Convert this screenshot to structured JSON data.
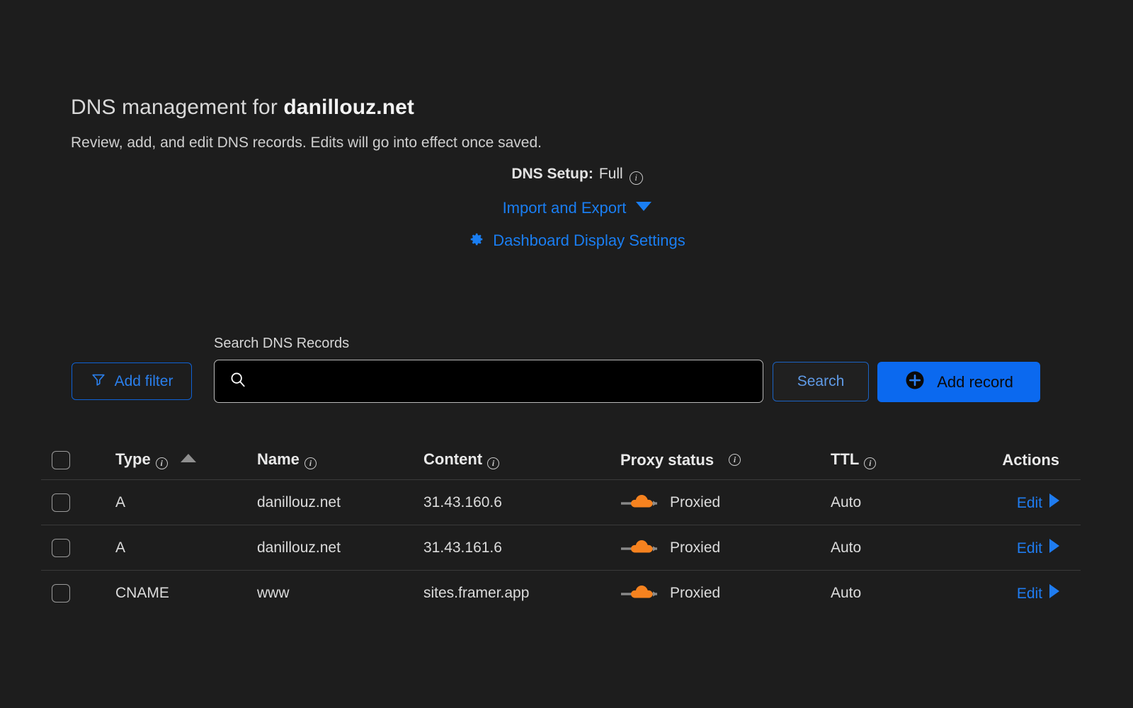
{
  "header": {
    "title_prefix": "DNS management for ",
    "domain": "danillouz.net",
    "subtitle": "Review, add, and edit DNS records. Edits will go into effect once saved.",
    "dns_setup_label": "DNS Setup:",
    "dns_setup_value": "Full",
    "info_icon": "info-icon",
    "import_export_label": "Import and Export",
    "dropdown_icon": "chevron-down-icon",
    "dashboard_settings_label": "Dashboard Display Settings",
    "gear_icon": "gear-icon"
  },
  "toolbar": {
    "add_filter_label": "Add filter",
    "filter_icon": "funnel-icon",
    "search_label": "Search DNS Records",
    "search_value": "",
    "search_placeholder": "",
    "search_icon": "search-icon",
    "search_button_label": "Search",
    "add_record_label": "Add record",
    "add_record_icon": "plus-circle-icon"
  },
  "table": {
    "columns": [
      {
        "key": "type",
        "label": "Type",
        "info": true,
        "sorted": "asc"
      },
      {
        "key": "name",
        "label": "Name",
        "info": true
      },
      {
        "key": "content",
        "label": "Content",
        "info": true
      },
      {
        "key": "proxy_status",
        "label": "Proxy status",
        "info": true
      },
      {
        "key": "ttl",
        "label": "TTL",
        "info": true
      },
      {
        "key": "actions",
        "label": "Actions",
        "info": false
      }
    ],
    "rows": [
      {
        "type": "A",
        "name": "danillouz.net",
        "content": "31.43.160.6",
        "proxy_status": "Proxied",
        "proxy_icon": "cloud-proxied-icon",
        "ttl": "Auto",
        "action_label": "Edit"
      },
      {
        "type": "A",
        "name": "danillouz.net",
        "content": "31.43.161.6",
        "proxy_status": "Proxied",
        "proxy_icon": "cloud-proxied-icon",
        "ttl": "Auto",
        "action_label": "Edit"
      },
      {
        "type": "CNAME",
        "name": "www",
        "content": "sites.framer.app",
        "proxy_status": "Proxied",
        "proxy_icon": "cloud-proxied-icon",
        "ttl": "Auto",
        "action_label": "Edit"
      }
    ]
  },
  "colors": {
    "background": "#1d1d1d",
    "accent_blue": "#0b69ef",
    "link_blue": "#1a7ef2",
    "proxy_orange": "#f6821f",
    "text_primary": "#e9e9e9",
    "text_secondary": "#cfcfcf",
    "border": "#3a3a3a"
  }
}
